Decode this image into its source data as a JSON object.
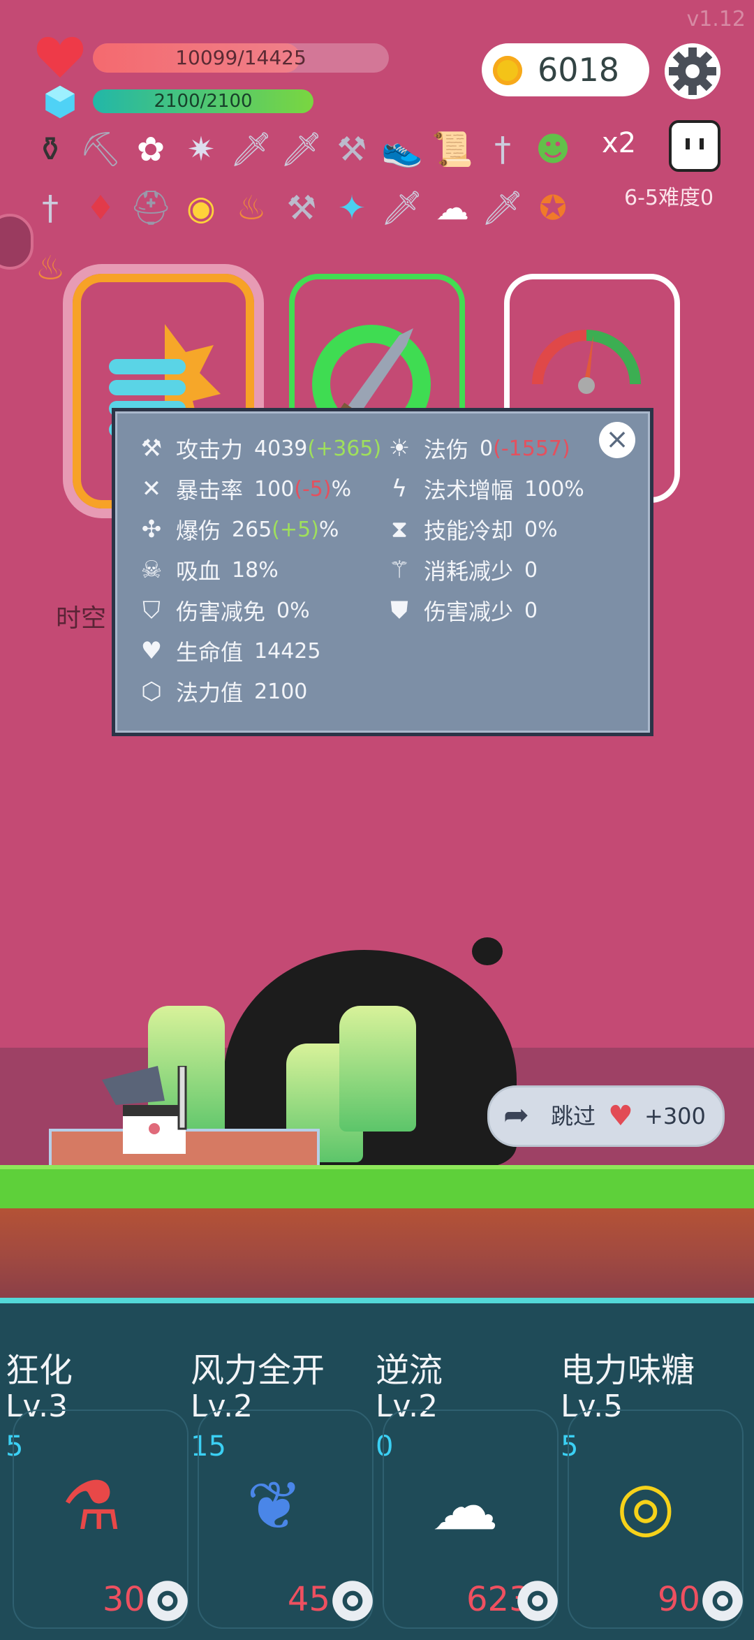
{
  "version": "v1.12",
  "hp": {
    "text": "10099/14425",
    "fraction": 0.7
  },
  "mp": {
    "text": "2100/2100",
    "fraction": 1.0
  },
  "coins": "6018",
  "multiplier": "x2",
  "difficulty": "6-5难度0",
  "items_row1": [
    "cauldron-icon",
    "axe-icon",
    "flower-icon",
    "mace-icon",
    "sword-icon",
    "sword-icon",
    "hammer-icon",
    "sneaker-icon",
    "scroll-icon",
    "dagger-icon",
    "slime-icon"
  ],
  "items_row2": [
    "dagger-icon",
    "gem-icon",
    "horned-helmet-icon",
    "egg-icon",
    "flame-icon",
    "hammer-icon",
    "crystal-icon",
    "sword-icon",
    "wing-icon",
    "sword-icon",
    "medal-icon"
  ],
  "items_row3": [
    "flame-icon"
  ],
  "time_label": "时空",
  "stats": {
    "attack": {
      "label": "攻击力",
      "value": "4039",
      "delta": "(+365)"
    },
    "spell_damage": {
      "label": "法伤",
      "value": "0",
      "delta": "(-1557)"
    },
    "crit_rate": {
      "label": "暴击率",
      "value": "100",
      "delta": "(-5)",
      "unit": "%"
    },
    "spell_amp": {
      "label": "法术增幅",
      "value": "100%"
    },
    "crit_damage": {
      "label": "爆伤",
      "value": "265",
      "delta": "(+5)",
      "unit": "%"
    },
    "cooldown": {
      "label": "技能冷却",
      "value": "0%"
    },
    "lifesteal": {
      "label": "吸血",
      "value": "18%"
    },
    "cost_reduction": {
      "label": "消耗减少",
      "value": "0"
    },
    "damage_immunity": {
      "label": "伤害减免",
      "value": "0%"
    },
    "damage_reduction": {
      "label": "伤害减少",
      "value": "0"
    },
    "life": {
      "label": "生命值",
      "value": "14425"
    },
    "mana": {
      "label": "法力值",
      "value": "2100"
    }
  },
  "skip": {
    "label": "跳过",
    "amount": "+300"
  },
  "skills": [
    {
      "name": "狂化",
      "level": "Lv.3",
      "count": "5",
      "cost": "30",
      "icon": "potion-icon"
    },
    {
      "name": "风力全开",
      "level": "Lv.2",
      "count": "15",
      "cost": "45",
      "icon": "feather-icon"
    },
    {
      "name": "逆流",
      "level": "Lv.2",
      "count": "0",
      "cost": "623",
      "icon": "wing-icon"
    },
    {
      "name": "电力味糖",
      "level": "Lv.5",
      "count": "5",
      "cost": "90",
      "icon": "lollipop-icon"
    }
  ],
  "colors": {
    "background": "#c44a74",
    "panel": "#7d8fa6",
    "bottom": "#1f4b58",
    "accent_orange": "#f7a227",
    "accent_green": "#42dd52"
  }
}
